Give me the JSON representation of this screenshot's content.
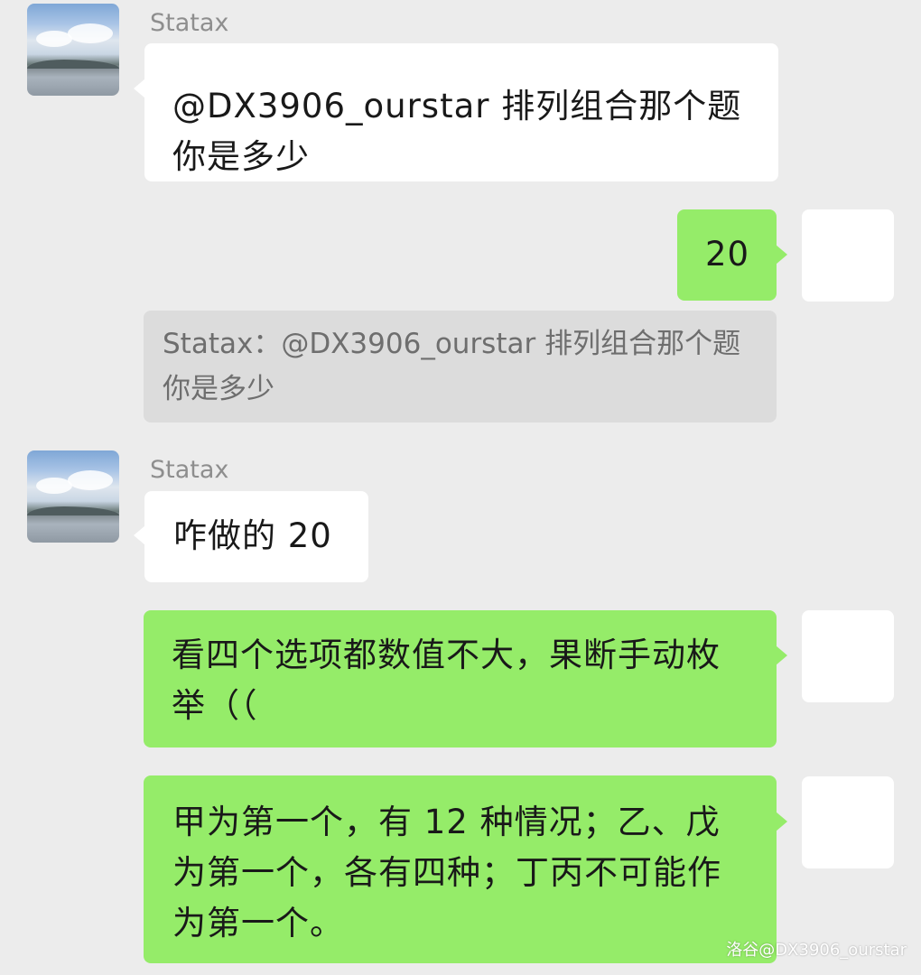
{
  "messages": [
    {
      "sender": "Statax",
      "side": "left",
      "text": "@DX3906_ourstar  排列组合那个题你是多少"
    },
    {
      "side": "right",
      "text": "20",
      "quote": "Statax：@DX3906_ourstar 排列组合那个题你是多少"
    },
    {
      "sender": "Statax",
      "side": "left",
      "text": "咋做的 20"
    },
    {
      "side": "right",
      "text": "看四个选项都数值不大，果断手动枚举（（"
    },
    {
      "side": "right",
      "text": "甲为第一个，有 12 种情况；乙、戊为第一个，各有四种；丁丙不可能作为第一个。"
    }
  ],
  "watermark": "洛谷@DX3906_ourstar",
  "colors": {
    "background": "#ececec",
    "incoming_bubble": "#ffffff",
    "outgoing_bubble": "#95ec69",
    "quote_background": "#dcdcdc"
  }
}
